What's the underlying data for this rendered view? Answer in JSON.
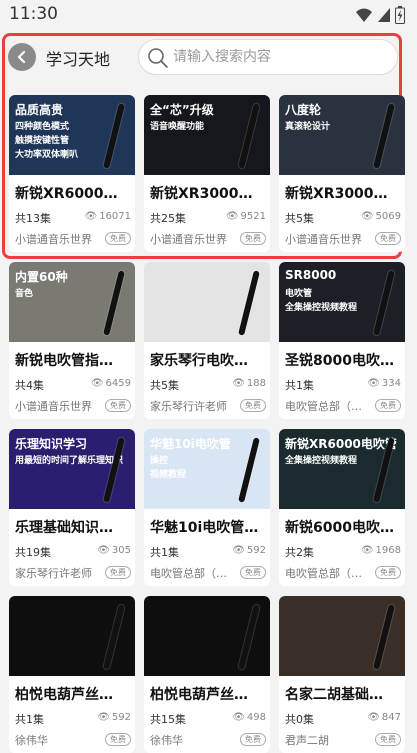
{
  "status": {
    "time": "11:30"
  },
  "header": {
    "title": "学习天地",
    "search_placeholder": "请输入搜索内容"
  },
  "cards": [
    {
      "title": "新锐XR6000音…",
      "episodes": "共13集",
      "views": "16071",
      "author": "小谱通音乐世界",
      "badge": "免费",
      "thumb": {
        "bg": "#1f3658",
        "text": "品质高贵",
        "lines": [
          "四种颜色模式",
          "触摸按键性管",
          "大功率双体喇叭"
        ]
      }
    },
    {
      "title": "新锐XR3000功…",
      "episodes": "共25集",
      "views": "9521",
      "author": "小谱通音乐世界",
      "badge": "免费",
      "thumb": {
        "bg": "#15171c",
        "text": "全“芯”升级",
        "lines": [
          "语音唤醒功能"
        ]
      }
    },
    {
      "title": "新锐XR3000故…",
      "episodes": "共5集",
      "views": "5069",
      "author": "小谱通音乐世界",
      "badge": "免费",
      "thumb": {
        "bg": "#2a3240",
        "text": "八度轮",
        "lines": [
          "真滚轮设计"
        ]
      }
    },
    {
      "title": "新锐电吹管指…",
      "episodes": "共4集",
      "views": "6459",
      "author": "小谱通音乐世界",
      "badge": "免费",
      "thumb": {
        "bg": "#7a7a72",
        "text": "内置60种",
        "lines": [
          "音色"
        ]
      }
    },
    {
      "title": "家乐琴行电吹…",
      "episodes": "共5集",
      "views": "188",
      "author": "家乐琴行许老师",
      "badge": "免费",
      "thumb": {
        "bg": "#e4e4e4",
        "text": "",
        "lines": []
      }
    },
    {
      "title": "圣锐8000电吹…",
      "episodes": "共1集",
      "views": "334",
      "author": "电吹管总部（…",
      "badge": "免费",
      "thumb": {
        "bg": "#1c2026",
        "text": "SR8000",
        "lines": [
          "电吹管",
          "全集操控视频教程"
        ]
      }
    },
    {
      "title": "乐理基础知识…",
      "episodes": "共19集",
      "views": "305",
      "author": "家乐琴行许老师",
      "badge": "免费",
      "thumb": {
        "bg": "#2a1f6e",
        "text": "乐理知识学习",
        "lines": [
          "用最短的时间了解乐理知识"
        ]
      }
    },
    {
      "title": "华魅10i电吹管…",
      "episodes": "共1集",
      "views": "592",
      "author": "电吹管总部（…",
      "badge": "免费",
      "thumb": {
        "bg": "#d8e6f4",
        "text": "华魅10i电吹管",
        "lines": [
          "操控",
          "视频教程"
        ]
      }
    },
    {
      "title": "新锐6000电吹…",
      "episodes": "共2集",
      "views": "1968",
      "author": "电吹管总部（…",
      "badge": "免费",
      "thumb": {
        "bg": "#1a2a2e",
        "text": "新锐XR6000电吹管",
        "lines": [
          "全集操控视频教程"
        ]
      }
    },
    {
      "title": "柏悦电葫芦丝…",
      "episodes": "共1集",
      "views": "592",
      "author": "徐伟华",
      "badge": "免费",
      "thumb": {
        "bg": "#0e0e0e",
        "text": "",
        "lines": []
      }
    },
    {
      "title": "柏悦电葫芦丝…",
      "episodes": "共15集",
      "views": "498",
      "author": "徐伟华",
      "badge": "免费",
      "thumb": {
        "bg": "#0e0e0e",
        "text": "",
        "lines": []
      }
    },
    {
      "title": "名家二胡基础…",
      "episodes": "共0集",
      "views": "847",
      "author": "君声二胡",
      "badge": "免费",
      "thumb": {
        "bg": "#3a2f26",
        "text": "",
        "lines": []
      }
    }
  ]
}
